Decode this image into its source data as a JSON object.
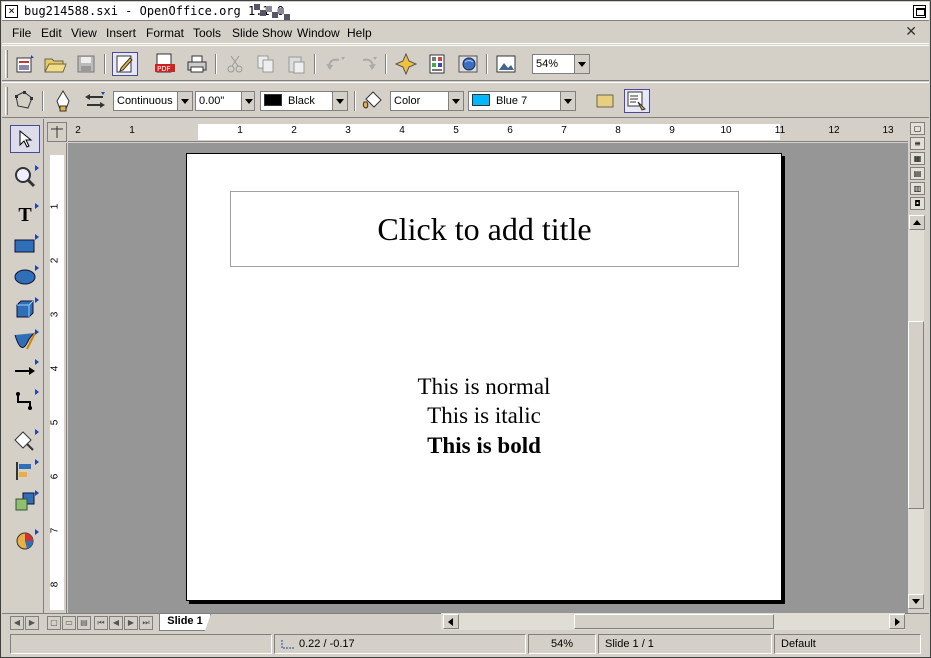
{
  "window": {
    "title": "bug214588.sxi - OpenOffice.org 1.1.0"
  },
  "menubar": {
    "items": [
      "File",
      "Edit",
      "View",
      "Insert",
      "Format",
      "Tools",
      "Slide Show",
      "Window",
      "Help"
    ]
  },
  "toolbar": {
    "zoom_value": "54%",
    "line_style": "Continuous",
    "line_width": "0.00\"",
    "line_color": "Black",
    "line_color_hex": "#000000",
    "area_style": "Color",
    "area_color": "Blue 7",
    "area_color_hex": "#00b8ff"
  },
  "rulers": {
    "horizontal_labels": [
      "2",
      "1",
      "1",
      "2",
      "3",
      "4",
      "5",
      "6",
      "7",
      "8",
      "9",
      "10",
      "11",
      "12",
      "13"
    ],
    "vertical_labels": [
      "1",
      "2",
      "3",
      "4",
      "5",
      "6",
      "7",
      "8"
    ]
  },
  "slide": {
    "title_placeholder": "Click to add title",
    "lines": [
      {
        "text": "This is normal",
        "style": "normal"
      },
      {
        "text": "This is italic",
        "style": "normal"
      },
      {
        "text": "This is bold",
        "style": "bold"
      }
    ]
  },
  "tabs": {
    "slide_tab": "Slide 1"
  },
  "statusbar": {
    "position": "0.22 / -0.17",
    "zoom": "54%",
    "slide": "Slide 1 / 1",
    "layout": "Default"
  },
  "colors": {
    "canvas_bg": "#969696",
    "chrome_bg": "#d4d0c8",
    "accent": "#2244aa"
  }
}
